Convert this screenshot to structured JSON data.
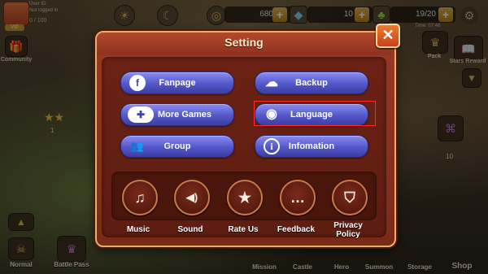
{
  "hud": {
    "user_id": "User ID:",
    "login_status": "Not logged in",
    "vip_label": "VIP",
    "exp": "0 / 100",
    "gold": "680",
    "gems": "10",
    "stamina": "19/20",
    "stamina_timer": "Time: 07:48",
    "left_side": [
      "Community"
    ],
    "right_side": [
      "Pack",
      "Stars Reward"
    ],
    "bottom_left": [
      "Normal",
      "Battle Pass"
    ],
    "bottom_nav": [
      "Mission",
      "Castle",
      "Hero",
      "Summon",
      "Storage",
      "Shop"
    ],
    "side_values": [
      "1",
      "10"
    ]
  },
  "dialog": {
    "title": "Setting",
    "close_symbol": "✕",
    "buttons": [
      {
        "label": "Fanpage",
        "icon": "facebook-icon",
        "glyph": "f"
      },
      {
        "label": "Backup",
        "icon": "cloud-upload-icon",
        "glyph": "☁"
      },
      {
        "label": "More Games",
        "icon": "gamepad-icon",
        "glyph": "✚"
      },
      {
        "label": "Language",
        "icon": "globe-icon",
        "glyph": "◉"
      },
      {
        "label": "Group",
        "icon": "group-icon",
        "glyph": "👥"
      },
      {
        "label": "Infomation",
        "icon": "info-icon",
        "glyph": "i"
      }
    ],
    "round_buttons": [
      {
        "label": "Music",
        "icon": "music-note-icon",
        "glyph": "♫"
      },
      {
        "label": "Sound",
        "icon": "speaker-icon",
        "glyph": "◀)"
      },
      {
        "label": "Rate Us",
        "icon": "star-icon",
        "glyph": "★"
      },
      {
        "label": "Feedback",
        "icon": "chat-bubble-icon",
        "glyph": "…"
      },
      {
        "label": "Privacy Policy",
        "icon": "shield-document-icon",
        "glyph": "⛉"
      }
    ]
  },
  "colors": {
    "dialog_frame": "#e6b067",
    "dialog_bg": "#8c3220",
    "button_blue": "#5356c8",
    "highlight": "#ff2a2a"
  }
}
